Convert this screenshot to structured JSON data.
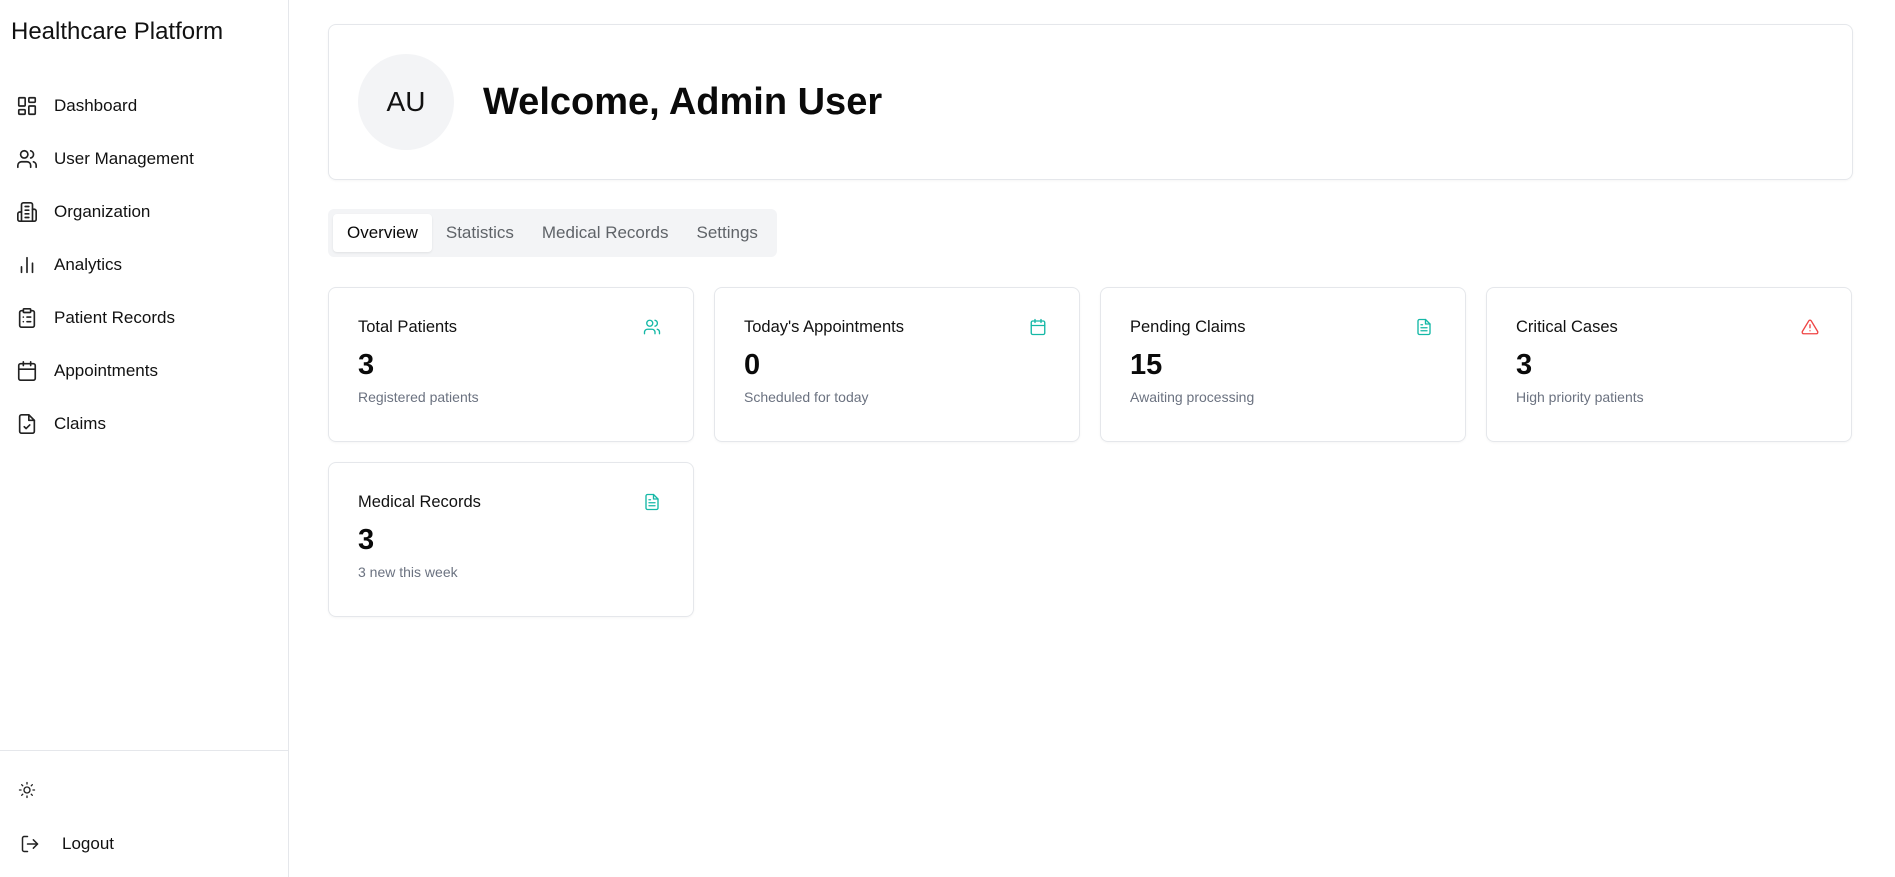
{
  "app": {
    "title": "Healthcare Platform"
  },
  "colors": {
    "accent": "#14b8a6",
    "danger": "#ef4444"
  },
  "sidebar": {
    "items": [
      {
        "label": "Dashboard",
        "icon": "dashboard-icon"
      },
      {
        "label": "User Management",
        "icon": "users-icon"
      },
      {
        "label": "Organization",
        "icon": "building-icon"
      },
      {
        "label": "Analytics",
        "icon": "bar-chart-icon"
      },
      {
        "label": "Patient Records",
        "icon": "clipboard-list-icon"
      },
      {
        "label": "Appointments",
        "icon": "calendar-icon"
      },
      {
        "label": "Claims",
        "icon": "file-check-icon"
      }
    ],
    "theme_icon": "sun-icon",
    "logout_label": "Logout"
  },
  "welcome": {
    "avatar_initials": "AU",
    "title": "Welcome, Admin User"
  },
  "tabs": [
    {
      "label": "Overview",
      "active": true
    },
    {
      "label": "Statistics",
      "active": false
    },
    {
      "label": "Medical Records",
      "active": false
    },
    {
      "label": "Settings",
      "active": false
    }
  ],
  "stats": [
    {
      "title": "Total Patients",
      "value": "3",
      "subtitle": "Registered patients",
      "icon": "users-icon"
    },
    {
      "title": "Today's Appointments",
      "value": "0",
      "subtitle": "Scheduled for today",
      "icon": "calendar-icon"
    },
    {
      "title": "Pending Claims",
      "value": "15",
      "subtitle": "Awaiting processing",
      "icon": "file-text-icon"
    },
    {
      "title": "Critical Cases",
      "value": "3",
      "subtitle": "High priority patients",
      "icon": "alert-triangle-icon"
    },
    {
      "title": "Medical Records",
      "value": "3",
      "subtitle": "3 new this week",
      "icon": "file-text-icon"
    }
  ]
}
